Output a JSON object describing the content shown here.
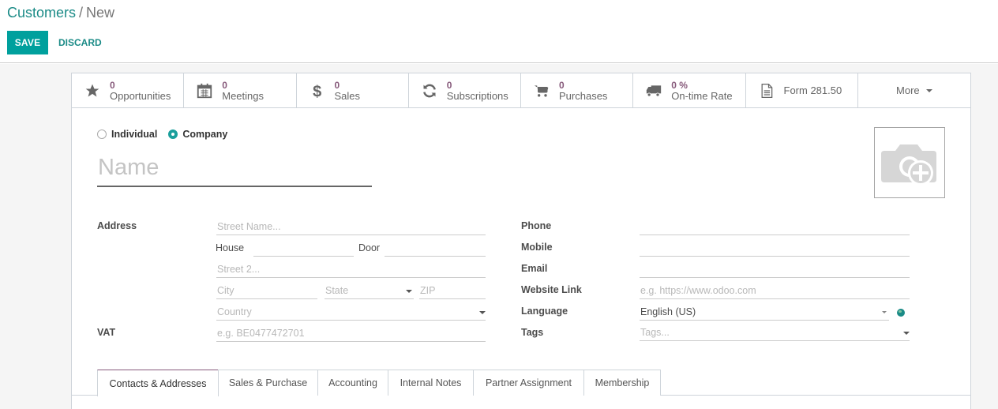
{
  "breadcrumb": {
    "parent": "Customers",
    "separator": "/",
    "current": "New"
  },
  "toolbar": {
    "save_label": "SAVE",
    "discard_label": "DISCARD"
  },
  "colors": {
    "primary": "#00a09d",
    "link": "#1b8b87",
    "stat_value": "#875a7b",
    "active_tab": "#875a7b"
  },
  "smart_buttons": [
    {
      "icon": "star-icon",
      "value": "0",
      "label": "Opportunities"
    },
    {
      "icon": "calendar-icon",
      "value": "0",
      "label": "Meetings"
    },
    {
      "icon": "dollar-icon",
      "value": "0",
      "label": "Sales"
    },
    {
      "icon": "refresh-icon",
      "value": "0",
      "label": "Subscriptions"
    },
    {
      "icon": "cart-icon",
      "value": "0",
      "label": "Purchases"
    },
    {
      "icon": "truck-icon",
      "value": "0 %",
      "label": "On-time Rate"
    },
    {
      "icon": "document-icon",
      "label": "Form 281.50"
    },
    {
      "label": "More"
    }
  ],
  "company_type": {
    "options": [
      "Individual",
      "Company"
    ],
    "selected": "Company"
  },
  "name": {
    "placeholder": "Name",
    "value": ""
  },
  "address": {
    "label": "Address",
    "street_placeholder": "Street Name...",
    "house_label": "House",
    "door_label": "Door",
    "street2_placeholder": "Street 2...",
    "city_placeholder": "City",
    "state_placeholder": "State",
    "zip_placeholder": "ZIP",
    "country_placeholder": "Country"
  },
  "vat": {
    "label": "VAT",
    "placeholder": "e.g. BE0477472701"
  },
  "phone": {
    "label": "Phone",
    "value": ""
  },
  "mobile": {
    "label": "Mobile",
    "value": ""
  },
  "email": {
    "label": "Email",
    "value": ""
  },
  "website": {
    "label": "Website Link",
    "placeholder": "e.g. https://www.odoo.com"
  },
  "language": {
    "label": "Language",
    "value": "English (US)"
  },
  "tags": {
    "label": "Tags",
    "placeholder": "Tags..."
  },
  "tabs": [
    {
      "label": "Contacts & Addresses",
      "active": true
    },
    {
      "label": "Sales & Purchase"
    },
    {
      "label": "Accounting"
    },
    {
      "label": "Internal Notes"
    },
    {
      "label": "Partner Assignment"
    },
    {
      "label": "Membership"
    }
  ]
}
